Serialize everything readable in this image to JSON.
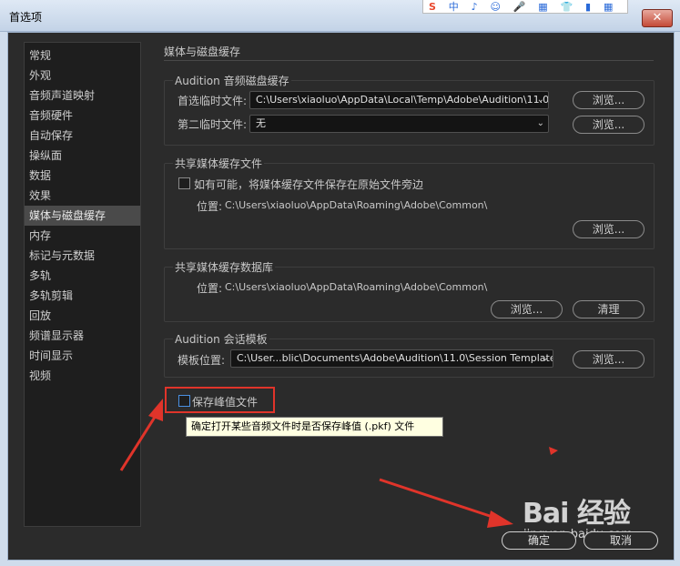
{
  "window": {
    "title": "首选项",
    "close_glyph": "✕"
  },
  "ime": {
    "logo": "S",
    "items": [
      "中",
      "♪",
      "☺",
      "🎤",
      "▦",
      "👕",
      "▮",
      "▦"
    ]
  },
  "sidebar": {
    "items": [
      {
        "label": "常规"
      },
      {
        "label": "外观"
      },
      {
        "label": "音频声道映射"
      },
      {
        "label": "音频硬件"
      },
      {
        "label": "自动保存"
      },
      {
        "label": "操纵面"
      },
      {
        "label": "数据"
      },
      {
        "label": "效果"
      },
      {
        "label": "媒体与磁盘缓存",
        "active": true
      },
      {
        "label": "内存"
      },
      {
        "label": "标记与元数据"
      },
      {
        "label": "多轨"
      },
      {
        "label": "多轨剪辑"
      },
      {
        "label": "回放"
      },
      {
        "label": "频谱显示器"
      },
      {
        "label": "时间显示"
      },
      {
        "label": "视频"
      }
    ]
  },
  "panel": {
    "title": "媒体与磁盘缓存",
    "audio_cache": {
      "label": "Audition 音频磁盘缓存",
      "primary_label": "首选临时文件:",
      "primary_value": "C:\\Users\\xiaoluo\\AppData\\Local\\Temp\\Adobe\\Audition\\11.0\\",
      "secondary_label": "第二临时文件:",
      "secondary_value": "无",
      "browse": "浏览..."
    },
    "shared_cache_files": {
      "label": "共享媒体缓存文件",
      "checkbox_label": "如有可能，将媒体缓存文件保存在原始文件旁边",
      "location_label": "位置:",
      "location_value": "C:\\Users\\xiaoluo\\AppData\\Roaming\\Adobe\\Common\\",
      "browse": "浏览..."
    },
    "shared_cache_db": {
      "label": "共享媒体缓存数据库",
      "location_label": "位置:",
      "location_value": "C:\\Users\\xiaoluo\\AppData\\Roaming\\Adobe\\Common\\",
      "browse": "浏览...",
      "clean": "清理"
    },
    "session_template": {
      "label": "Audition 会话模板",
      "location_label": "模板位置:",
      "location_value": "C:\\User...blic\\Documents\\Adobe\\Audition\\11.0\\Session Templates",
      "browse": "浏览..."
    },
    "save_peak": {
      "label": "保存峰值文件",
      "checked": false
    },
    "tooltip": "确定打开某些音频文件时是否保存峰值 (.pkf) 文件"
  },
  "footer": {
    "ok": "确定",
    "cancel": "取消"
  },
  "watermark": {
    "main": "Bai 经验",
    "sub": "jingyan.baidu.com"
  },
  "colors": {
    "background": "#2b2b2b",
    "highlight": "#e0342a",
    "tooltip_bg": "#ffffe1"
  }
}
